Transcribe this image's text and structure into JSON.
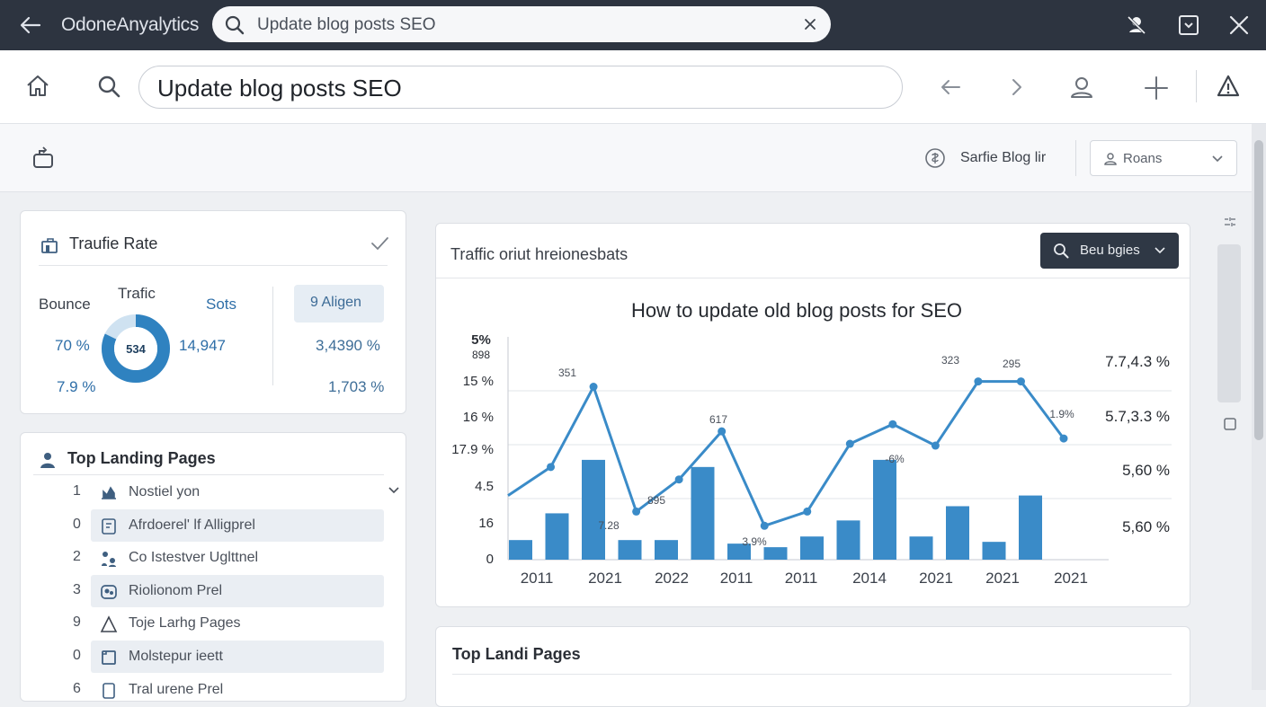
{
  "titlebar": {
    "app_name": "OdoneAnyalytics",
    "search_text": "Update blog posts SEO"
  },
  "toolbar": {
    "address_text": "Update blog posts SEO"
  },
  "subheader": {
    "profile_text": "Sarfie Blog lir",
    "select_value": "Roans"
  },
  "traffic_card": {
    "title": "Traufie Rate",
    "bounce_label": "Bounce",
    "traffic_label": "Trafic",
    "sots_label": "Sots",
    "donut_value": "534",
    "bounce_v1": "70 %",
    "bounce_v2": "7.9 %",
    "sots_v1": "14,947",
    "pill_label": "9 Aligen",
    "right_v1": "3,4390 %",
    "right_v2": "1,703 %",
    "donut_fraction": 0.82,
    "colors": {
      "accent": "#2f82c0"
    }
  },
  "landing_card": {
    "title": "Top Landing Pages",
    "rows": [
      {
        "num": "1",
        "icon": "chart-bars-icon",
        "label": "Nostiel yon",
        "highlight": false
      },
      {
        "num": "0",
        "icon": "document-icon",
        "label": "Afrdoerel' lf Alligprel",
        "highlight": true
      },
      {
        "num": "2",
        "icon": "users-icon",
        "label": "Co Istestver Uglttnel",
        "highlight": false
      },
      {
        "num": "3",
        "icon": "group-icon",
        "label": "Riolionom Prel",
        "highlight": true
      },
      {
        "num": "9",
        "icon": "triangle-icon",
        "label": "Toje Larhg Pages",
        "highlight": false
      },
      {
        "num": "0",
        "icon": "square-icon",
        "label": "Molstepur ieett",
        "highlight": true
      },
      {
        "num": "6",
        "icon": "page-icon",
        "label": "Tral urene Prel",
        "highlight": false
      }
    ]
  },
  "chart_card": {
    "header": "Traffic oriut hreionesbats",
    "button_label": "Beu bgies",
    "right_labels": [
      "7.7,4.3 %",
      "5.7,3.3 %",
      "5,60 %",
      "5,60 %"
    ]
  },
  "chart_data": {
    "type": "bar",
    "title": "How to update old blog posts for SEO",
    "categories": [
      "2011",
      "2021",
      "2022",
      "2011",
      "2011",
      "2014",
      "2021",
      "2021",
      "2021"
    ],
    "y_tick_labels": [
      "5%",
      "898",
      "15 %",
      "16 %",
      "17.9 %",
      "4.5",
      "16",
      "0"
    ],
    "series": [
      {
        "type": "bar",
        "values": [
          1.1,
          2.6,
          5.6,
          1.1,
          1.1,
          5.2,
          0.9,
          0.7,
          1.3,
          2.2,
          5.6,
          1.3,
          3.0,
          1.0,
          3.6
        ]
      },
      {
        "type": "line",
        "values": [
          3.6,
          5.2,
          9.7,
          2.7,
          4.5,
          7.2,
          1.9,
          2.7,
          6.5,
          7.6,
          6.4,
          10.0,
          10.0,
          6.8
        ]
      }
    ],
    "point_labels": [
      "351",
      "895",
      "7.28",
      "617",
      "3.9%",
      "-6%",
      "323",
      "295",
      "1.9%"
    ],
    "ylim": [
      0,
      12.5
    ],
    "colors": {
      "bar": "#3a8bc8",
      "line": "#3a8bc8",
      "grid": "#e2e5ea"
    }
  },
  "bottom_card": {
    "title": "Top Landi Pages"
  }
}
